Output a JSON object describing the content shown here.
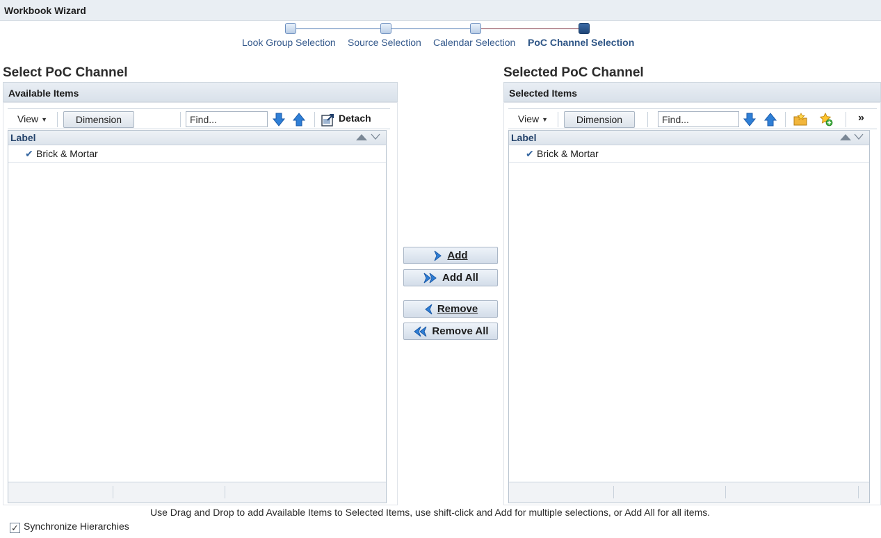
{
  "app": {
    "title": "Workbook Wizard"
  },
  "train": {
    "steps": [
      {
        "label": "Look Group Selection",
        "state": "visited"
      },
      {
        "label": "Source Selection",
        "state": "visited"
      },
      {
        "label": "Calendar Selection",
        "state": "visited"
      },
      {
        "label": "PoC Channel Selection",
        "state": "current"
      }
    ]
  },
  "left": {
    "title": "Select PoC Channel",
    "header": "Available Items",
    "toolbar": {
      "view": "View",
      "dimension": "Dimension",
      "find_placeholder": "Find...",
      "detach": "Detach"
    },
    "grid": {
      "column": "Label",
      "rows": [
        {
          "label": "Brick & Mortar",
          "checked": true
        }
      ]
    }
  },
  "right": {
    "title": "Selected PoC Channel",
    "header": "Selected Items",
    "toolbar": {
      "view": "View",
      "dimension": "Dimension",
      "find_placeholder": "Find...",
      "overflow": "»"
    },
    "grid": {
      "column": "Label",
      "rows": [
        {
          "label": "Brick & Mortar",
          "checked": true
        }
      ]
    }
  },
  "shuttle": {
    "add": "Add",
    "add_all": "Add All",
    "remove": "Remove",
    "remove_all": "Remove All"
  },
  "hint": "Use Drag and Drop to add Available Items to Selected Items, use shift-click and Add for multiple selections, or Add All for all items.",
  "sync": {
    "label": "Synchronize Hierarchies",
    "checked": true
  },
  "colors": {
    "accent": "#33588b",
    "current_step": "#1f4677",
    "arrow_blue": "#2f7fd6"
  }
}
